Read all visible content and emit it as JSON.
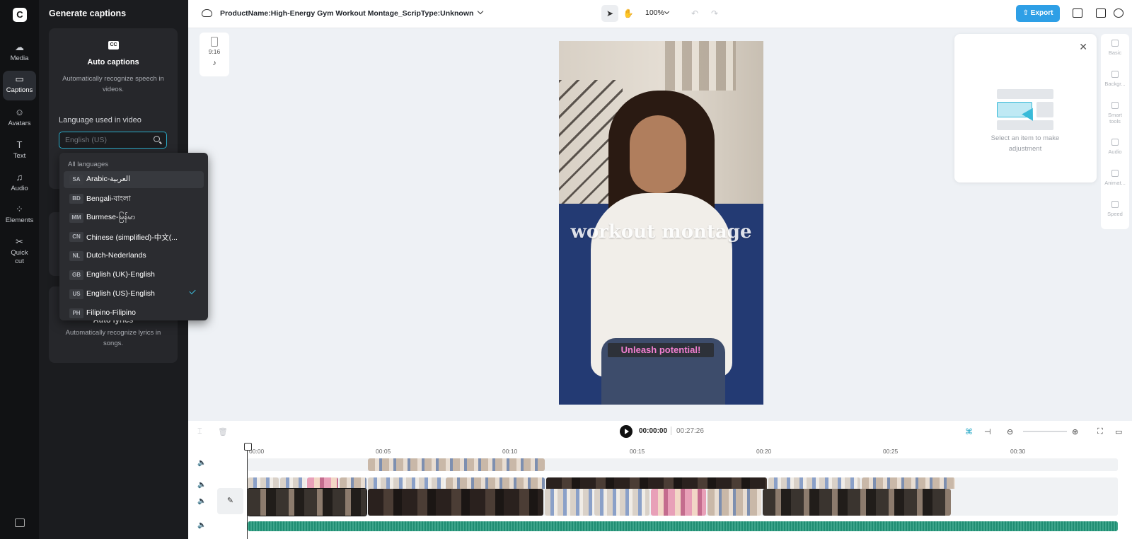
{
  "rail": {
    "items": [
      {
        "label": "Media",
        "icon": "cloud-upload-icon"
      },
      {
        "label": "Captions",
        "icon": "captions-icon"
      },
      {
        "label": "Avatars",
        "icon": "avatar-icon"
      },
      {
        "label": "Text",
        "icon": "text-icon"
      },
      {
        "label": "Audio",
        "icon": "music-note-icon"
      },
      {
        "label": "Elements",
        "icon": "elements-icon"
      },
      {
        "label": "Quick cut",
        "icon": "quick-cut-icon"
      }
    ],
    "active": "Captions"
  },
  "panel": {
    "title": "Generate captions",
    "auto_captions": {
      "icon": "CC",
      "title": "Auto captions",
      "description": "Automatically recognize speech in videos."
    },
    "language_label": "Language used in video",
    "language_placeholder": "English (US)",
    "lyrics": {
      "title": "Auto lyrics",
      "description": "Automatically recognize lyrics in songs."
    }
  },
  "dropdown": {
    "header": "All languages",
    "items": [
      {
        "code": "SA",
        "name": "Arabic-العربية"
      },
      {
        "code": "BD",
        "name": "Bengali-বাংলা"
      },
      {
        "code": "MM",
        "name": "Burmese-မြန်မာ"
      },
      {
        "code": "CN",
        "name": "Chinese (simplified)-中文(..."
      },
      {
        "code": "NL",
        "name": "Dutch-Nederlands"
      },
      {
        "code": "GB",
        "name": "English (UK)-English"
      },
      {
        "code": "US",
        "name": "English (US)-English"
      },
      {
        "code": "PH",
        "name": "Filipino-Filipino"
      }
    ],
    "selected": "English (US)-English",
    "hovered": "Arabic-العربية"
  },
  "topbar": {
    "project_title": "ProductName:High-Energy Gym Workout Montage_ScripType:Unknown",
    "zoom": "100%",
    "export_label": "Export"
  },
  "canvas": {
    "ratio": "9:16",
    "platform_icon": "tiktok-icon",
    "video_title": "workout montage",
    "video_caption": "Unleash potential!"
  },
  "properties": {
    "message": "Select an item to make adjustment",
    "tabs": [
      "Basic",
      "Backgr...",
      "Smart tools",
      "Audio",
      "Animat...",
      "Speed"
    ]
  },
  "timeline": {
    "current_time": "00:00:00",
    "total_time": "00:27:26",
    "ruler": [
      "00:00",
      "00:05",
      "00:10",
      "00:15",
      "00:20",
      "00:25",
      "00:30"
    ]
  },
  "colors": {
    "accent": "#2e9fe6",
    "focus": "#29a9c7",
    "caption_text": "#f27fd0",
    "panel_bg": "#1b1c1f"
  }
}
